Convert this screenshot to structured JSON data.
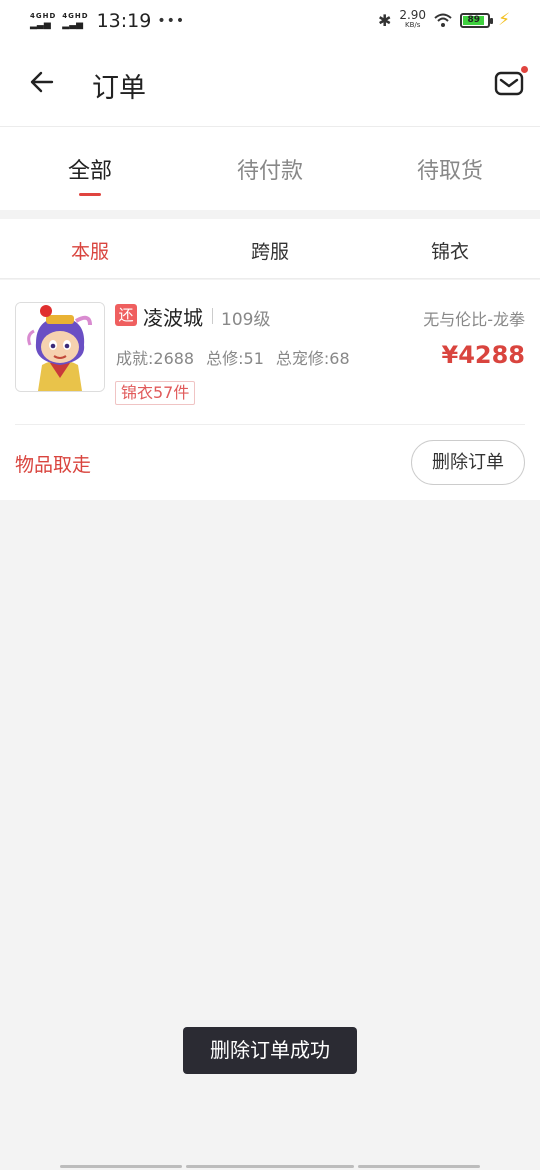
{
  "status_bar": {
    "signal1": "4GHD",
    "signal2": "4GHD",
    "time": "13:19",
    "more": "•••",
    "bluetooth_icon": "bluetooth-icon",
    "speed_value": "2.90",
    "speed_unit": "KB/s",
    "wifi_icon": "wifi-icon",
    "battery_level": "89",
    "charging_icon": "charging-icon"
  },
  "header": {
    "title": "订单",
    "back_icon": "arrow-left-icon",
    "mail_icon": "mail-icon"
  },
  "tabs": [
    {
      "label": "全部",
      "active": true
    },
    {
      "label": "待付款",
      "active": false
    },
    {
      "label": "待取货",
      "active": false
    }
  ],
  "subtabs": [
    {
      "label": "本服",
      "active": true
    },
    {
      "label": "跨服",
      "active": false
    },
    {
      "label": "锦衣",
      "active": false
    }
  ],
  "order": {
    "return_badge": "还",
    "server": "凌波城",
    "level": "109级",
    "character": "无与伦比-龙拳",
    "stats": [
      "成就:2688",
      "总修:51",
      "总宠修:68"
    ],
    "price": "¥4288",
    "tag": "锦衣57件",
    "status": "物品取走",
    "delete_label": "删除订单"
  },
  "toast": "删除订单成功",
  "colors": {
    "accent": "#d9443e",
    "background": "#f3f3f3",
    "toast_bg": "#2b2b33"
  }
}
